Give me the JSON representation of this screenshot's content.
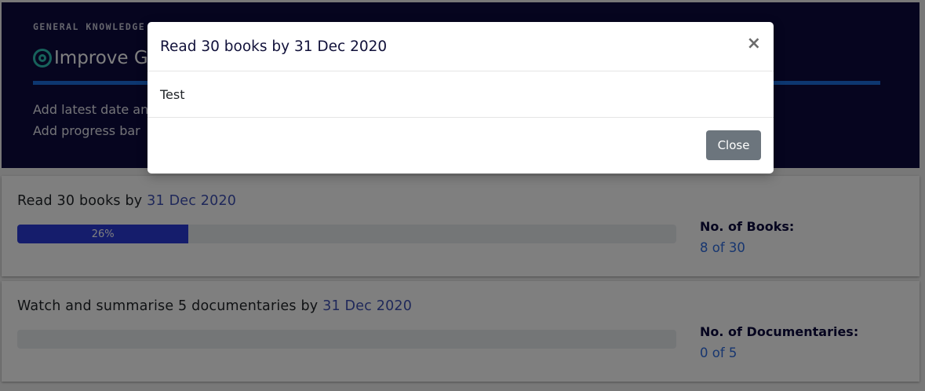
{
  "header": {
    "category": "GENERAL KNOWLEDGE",
    "goal_title": "Improve General Knowledge",
    "notes": [
      "Add latest date and time",
      "Add progress bar"
    ]
  },
  "goals": [
    {
      "title_prefix": "Read 30 books by ",
      "date": "31 Dec 2020",
      "progress_label": "26%",
      "progress_fraction": 0.26,
      "stat_label": "No. of Books:",
      "stat_value": "8 of 30"
    },
    {
      "title_prefix": "Watch and summarise 5 documentaries by ",
      "date": "31 Dec 2020",
      "progress_label": "",
      "progress_fraction": 0,
      "stat_label": "No. of Documentaries:",
      "stat_value": "0 of 5"
    }
  ],
  "modal": {
    "title": "Read 30 books by 31 Dec 2020",
    "close_icon_glyph": "×",
    "body_text": "Test",
    "close_button_label": "Close"
  },
  "colors": {
    "header_bg": "#0c0a3e",
    "accent_blue": "#1b6fe0",
    "progress_fill": "#2a3bd8",
    "link_blue": "#3f51b5",
    "target_icon": "#2ec4b6",
    "close_button_bg": "#6c757d"
  }
}
